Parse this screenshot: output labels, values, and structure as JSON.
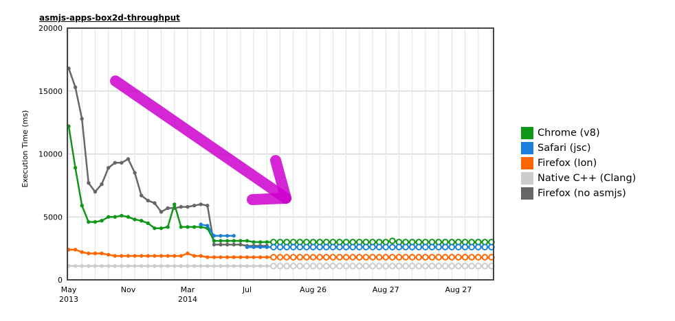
{
  "chart_data": {
    "type": "line",
    "title": "asmjs-apps-box2d-throughput",
    "ylabel": "Execution Time (ms)",
    "xlabel": "",
    "ylim": [
      0,
      20000
    ],
    "y_ticks": [
      "0",
      "5000",
      "10000",
      "15000",
      "20000"
    ],
    "x_tick_labels": [
      {
        "label": "May",
        "sub": "2013"
      },
      {
        "label": "Nov",
        "sub": ""
      },
      {
        "label": "Mar",
        "sub": "2014"
      },
      {
        "label": "Jul",
        "sub": ""
      },
      {
        "label": "Aug 26",
        "sub": ""
      },
      {
        "label": "Aug 27",
        "sub": ""
      },
      {
        "label": "Aug 27",
        "sub": ""
      }
    ],
    "grid": true,
    "legend_position": "right",
    "series": [
      {
        "name": "Firefox (no asmjs)",
        "color": "#666666",
        "values": [
          16800,
          15300,
          12800,
          7700,
          7000,
          7600,
          8900,
          9300,
          9300,
          9600,
          8500,
          6700,
          6300,
          6100,
          5400,
          5700,
          5700,
          5800,
          5800,
          5900,
          6000,
          5900,
          2800,
          2800,
          2800,
          2800,
          2800,
          2700,
          2700,
          2700,
          2700
        ]
      },
      {
        "name": "Chrome (v8)",
        "color": "#109618",
        "values": [
          12200,
          8900,
          5900,
          4600,
          4600,
          4700,
          5000,
          5000,
          5100,
          5000,
          4800,
          4700,
          4500,
          4100,
          4100,
          4200,
          6000,
          4200,
          4200,
          4200,
          4200,
          4100,
          3100,
          3100,
          3100,
          3100,
          3100,
          3100,
          3000,
          3000,
          3000,
          3000,
          3000,
          3000,
          3000,
          3000,
          3000,
          3000,
          3000,
          3000,
          3000,
          3000,
          3000,
          3000,
          3000,
          3000,
          3000,
          3000,
          3000,
          3100,
          3000,
          3000,
          3000,
          3000,
          3000,
          3000,
          3000,
          3000,
          3000,
          3000,
          3000,
          3000,
          3000,
          3000,
          3000
        ]
      },
      {
        "name": "Safari (jsc)",
        "color": "#1a7fd6",
        "values": [
          null,
          null,
          null,
          null,
          null,
          null,
          null,
          null,
          null,
          null,
          null,
          null,
          null,
          null,
          null,
          null,
          null,
          null,
          null,
          null,
          4400,
          4300,
          3500,
          3500,
          3500,
          3500,
          null,
          2600,
          2600,
          2600,
          2600,
          2600,
          2600,
          2600,
          2600,
          2600,
          2600,
          2600,
          2600,
          2600,
          2600,
          2600,
          2600,
          2600,
          2600,
          2600,
          2600,
          2600,
          2600,
          2600,
          2600,
          2600,
          2600,
          2600,
          2600,
          2600,
          2600,
          2600,
          2600,
          2600,
          2600,
          2600,
          2600,
          2600,
          2600
        ]
      },
      {
        "name": "Firefox (Ion)",
        "color": "#ff6600",
        "values": [
          2400,
          2400,
          2200,
          2100,
          2100,
          2100,
          2000,
          1900,
          1900,
          1900,
          1900,
          1900,
          1900,
          1900,
          1900,
          1900,
          1900,
          1900,
          2100,
          1900,
          1900,
          1800,
          1800,
          1800,
          1800,
          1800,
          1800,
          1800,
          1800,
          1800,
          1800,
          1800,
          1800,
          1800,
          1800,
          1800,
          1800,
          1800,
          1800,
          1800,
          1800,
          1800,
          1800,
          1800,
          1800,
          1800,
          1800,
          1800,
          1800,
          1800,
          1800,
          1800,
          1800,
          1800,
          1800,
          1800,
          1800,
          1800,
          1800,
          1800,
          1800,
          1800,
          1800,
          1800,
          1800
        ]
      },
      {
        "name": "Native C++ (Clang)",
        "color": "#cccccc",
        "values": [
          1100,
          1100,
          1100,
          1100,
          1100,
          1100,
          1100,
          1100,
          1100,
          1100,
          1100,
          1100,
          1100,
          1100,
          1100,
          1100,
          1100,
          1100,
          1100,
          1100,
          1100,
          1100,
          1100,
          1100,
          1100,
          1100,
          1100,
          1100,
          1100,
          1100,
          1100,
          1100,
          1100,
          1100,
          1100,
          1100,
          1100,
          1100,
          1100,
          1100,
          1100,
          1100,
          1100,
          1100,
          1100,
          1100,
          1100,
          1100,
          1100,
          1100,
          1100,
          1100,
          1100,
          1100,
          1100,
          1100,
          1100,
          1100,
          1100,
          1100,
          1100,
          1100,
          1100,
          1100,
          1100
        ]
      }
    ],
    "open_marker_from_index": 31,
    "annotation_arrow": {
      "color": "#cc00cc",
      "meaning": "downward-trend-arrow"
    }
  },
  "legend": [
    {
      "label": "Chrome (v8)",
      "color": "#109618"
    },
    {
      "label": "Safari (jsc)",
      "color": "#1a7fd6"
    },
    {
      "label": "Firefox (Ion)",
      "color": "#ff6600"
    },
    {
      "label": "Native C++ (Clang)",
      "color": "#cccccc"
    },
    {
      "label": "Firefox (no asmjs)",
      "color": "#666666"
    }
  ]
}
